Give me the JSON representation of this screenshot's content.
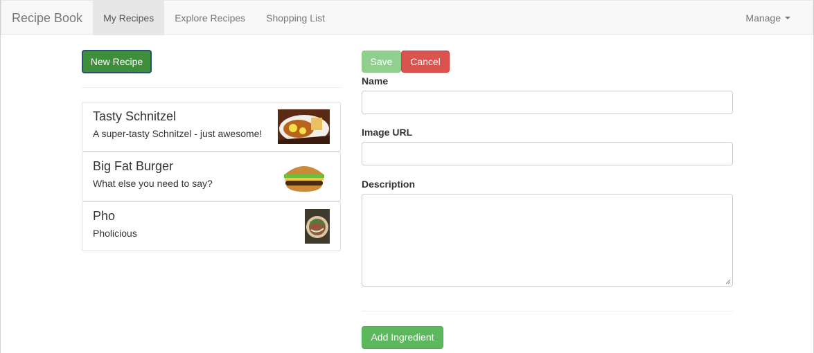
{
  "navbar": {
    "brand": "Recipe Book",
    "links": [
      "My Recipes",
      "Explore Recipes",
      "Shopping List"
    ],
    "manage_label": "Manage"
  },
  "list_panel": {
    "new_recipe_label": "New Recipe",
    "recipes": [
      {
        "title": "Tasty Schnitzel",
        "description": "A super-tasty Schnitzel - just awesome!"
      },
      {
        "title": "Big Fat Burger",
        "description": "What else you need to say?"
      },
      {
        "title": "Pho",
        "description": "Pholicious"
      }
    ]
  },
  "edit_form": {
    "save_label": "Save",
    "cancel_label": "Cancel",
    "name_label": "Name",
    "name_value": "",
    "image_url_label": "Image URL",
    "image_url_value": "",
    "description_label": "Description",
    "description_value": "",
    "add_ingredient_label": "Add Ingredient"
  },
  "colors": {
    "success": "#5cb85c",
    "danger": "#d9534f",
    "navbar_bg": "#f8f8f8"
  }
}
